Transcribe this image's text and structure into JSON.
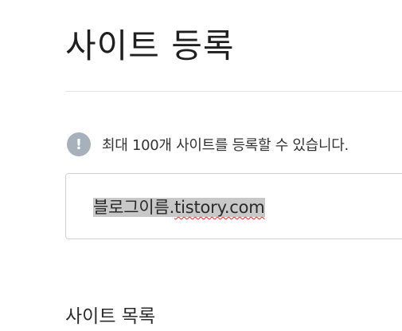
{
  "page": {
    "title": "사이트 등록"
  },
  "notice": {
    "icon": "exclamation-icon",
    "icon_glyph": "!",
    "icon_color": "#a7b1bb",
    "text": "최대 100개 사이트를 등록할 수 있습니다."
  },
  "site_input": {
    "value_prefix": "블로그이름.",
    "value_domain": "tistory.com",
    "selection_color": "#c8c8c8",
    "spellcheck_color": "#e0312b"
  },
  "site_list": {
    "title": "사이트 목록"
  }
}
